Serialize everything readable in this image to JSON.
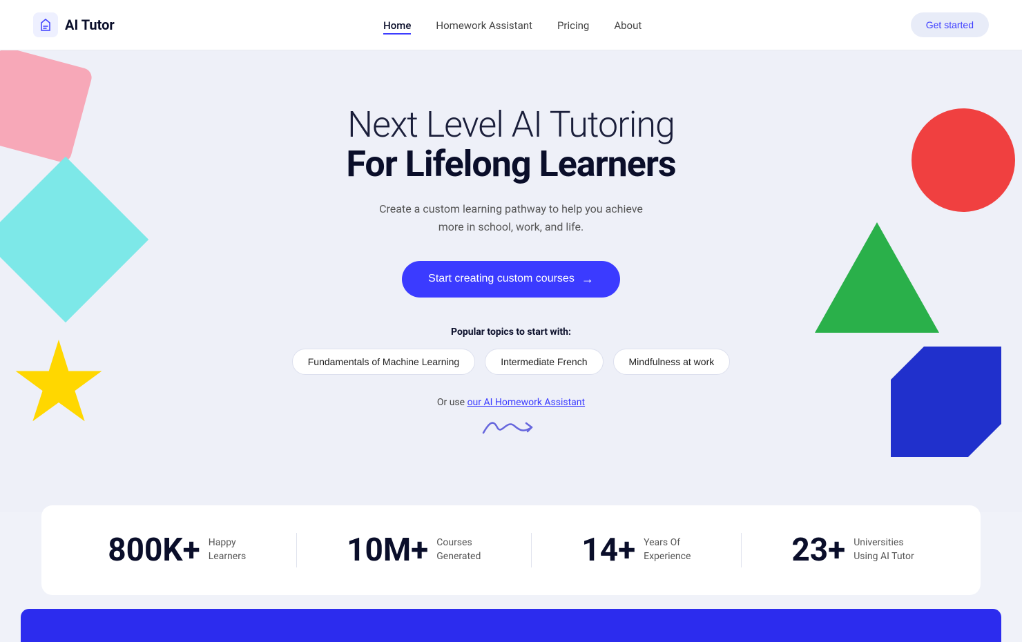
{
  "navbar": {
    "logo_text": "AI Tutor",
    "nav_items": [
      {
        "label": "Home",
        "active": true
      },
      {
        "label": "Homework Assistant",
        "active": false
      },
      {
        "label": "Pricing",
        "active": false
      },
      {
        "label": "About",
        "active": false
      }
    ],
    "cta_button": "Get started"
  },
  "hero": {
    "title_light": "Next Level AI Tutoring",
    "title_bold": "For Lifelong Learners",
    "subtitle_line1": "Create a custom learning pathway to help you achieve",
    "subtitle_line2": "more in school, work, and life.",
    "cta_button": "Start creating custom courses",
    "popular_label": "Popular topics to start with:",
    "topics": [
      "Fundamentals of Machine Learning",
      "Intermediate French",
      "Mindfulness at work"
    ],
    "or_use_text": "Or use ",
    "or_use_link": "our AI Homework Assistant"
  },
  "stats": [
    {
      "number": "800K+",
      "label_line1": "Happy",
      "label_line2": "Learners"
    },
    {
      "number": "10M+",
      "label_line1": "Courses",
      "label_line2": "Generated"
    },
    {
      "number": "14+",
      "label_line1": "Years Of",
      "label_line2": "Experience"
    },
    {
      "number": "23+",
      "label_line1": "Universities",
      "label_line2": "Using AI Tutor"
    }
  ]
}
